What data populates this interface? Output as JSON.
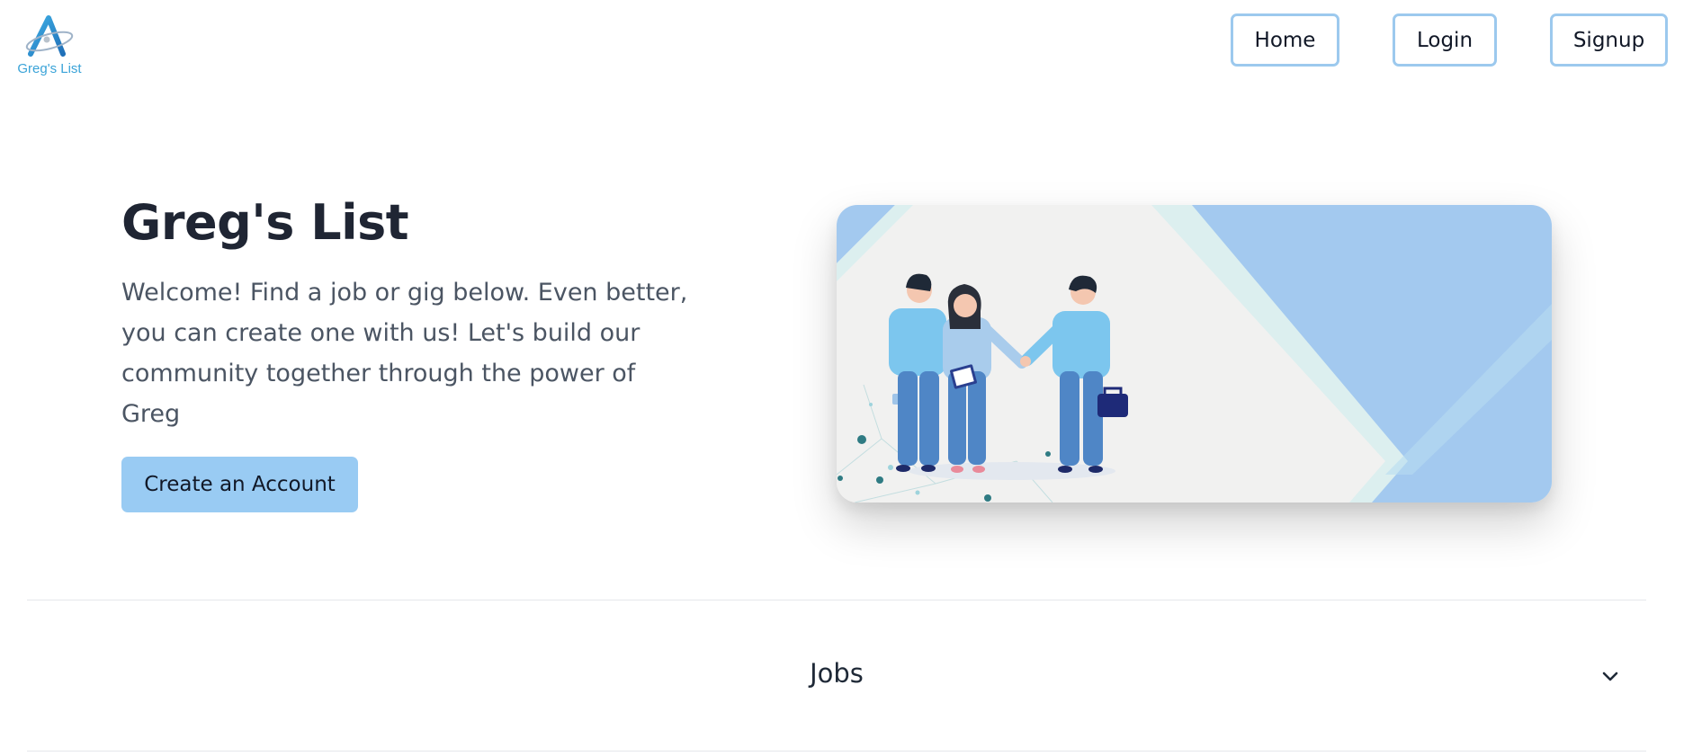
{
  "header": {
    "logo_text": "Greg's List",
    "logo_icon": "greg-a-logo-icon",
    "nav": {
      "home": "Home",
      "login": "Login",
      "signup": "Signup"
    }
  },
  "hero": {
    "title": "Greg's List",
    "description": "Welcome! Find a job or gig below. Even better, you can create one with us! Let's build our community together through the power of Greg",
    "cta_label": "Create an Account",
    "image_icon": "team-handshake-illustration"
  },
  "accordion": {
    "jobs_label": "Jobs",
    "expand_icon": "chevron-down-icon"
  },
  "colors": {
    "accent": "#99cbf3",
    "nav_border": "#9cc9ee",
    "logo_blue": "#3aa3d8",
    "illustration_blue": "#a3c9ef"
  }
}
